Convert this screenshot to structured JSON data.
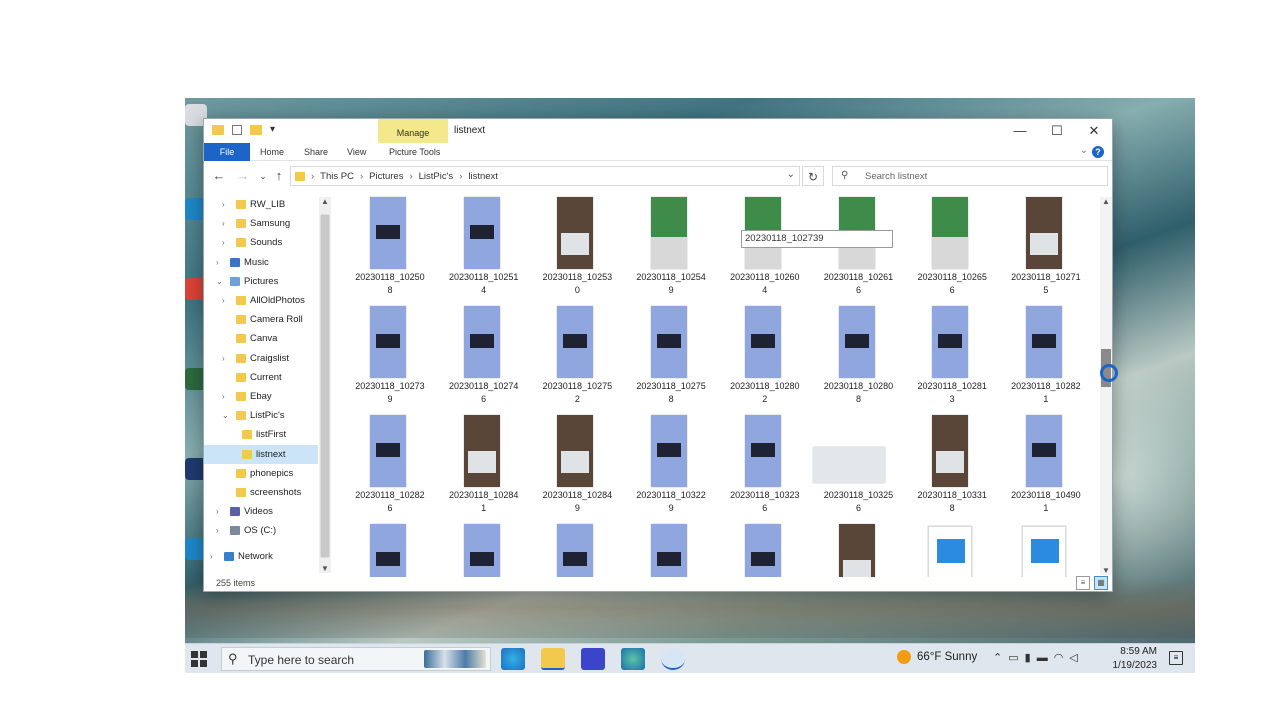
{
  "window": {
    "title": "listnext",
    "manage_tab": "Manage",
    "minimize": "—",
    "maximize": "☐",
    "close": "✕"
  },
  "ribbon": {
    "tabs": [
      "File",
      "Home",
      "Share",
      "View",
      "Picture Tools"
    ],
    "help": "?"
  },
  "address": {
    "crumbs": [
      "This PC",
      "Pictures",
      "ListPic's",
      "listnext"
    ],
    "search_placeholder": "Search listnext"
  },
  "nav_tree": [
    {
      "label": "RW_LIB",
      "indent": 2,
      "exp": ">",
      "kind": "folder"
    },
    {
      "label": "Samsung",
      "indent": 2,
      "exp": ">",
      "kind": "folder"
    },
    {
      "label": "Sounds",
      "indent": 2,
      "exp": ">",
      "kind": "folder"
    },
    {
      "label": "Music",
      "indent": 1,
      "exp": ">",
      "kind": "music"
    },
    {
      "label": "Pictures",
      "indent": 1,
      "exp": "v",
      "kind": "pictures"
    },
    {
      "label": "AllOldPhotos",
      "indent": 2,
      "exp": ">",
      "kind": "folder"
    },
    {
      "label": "Camera Roll",
      "indent": 2,
      "exp": "",
      "kind": "folder"
    },
    {
      "label": "Canva",
      "indent": 2,
      "exp": "",
      "kind": "folder"
    },
    {
      "label": "Craigslist",
      "indent": 2,
      "exp": ">",
      "kind": "folder"
    },
    {
      "label": "Current",
      "indent": 2,
      "exp": "",
      "kind": "folder"
    },
    {
      "label": "Ebay",
      "indent": 2,
      "exp": ">",
      "kind": "folder"
    },
    {
      "label": "ListPic's",
      "indent": 2,
      "exp": "v",
      "kind": "folder"
    },
    {
      "label": "listFirst",
      "indent": 3,
      "exp": "",
      "kind": "folder"
    },
    {
      "label": "listnext",
      "indent": 3,
      "exp": "",
      "kind": "folder",
      "selected": true
    },
    {
      "label": "phonepics",
      "indent": 2,
      "exp": "",
      "kind": "folder"
    },
    {
      "label": "screenshots",
      "indent": 2,
      "exp": "",
      "kind": "folder"
    },
    {
      "label": "Videos",
      "indent": 1,
      "exp": ">",
      "kind": "videos"
    },
    {
      "label": "OS (C:)",
      "indent": 1,
      "exp": ">",
      "kind": "drive"
    },
    {
      "label": "Network",
      "indent": 0,
      "exp": ">",
      "kind": "network"
    }
  ],
  "status": {
    "items_count": "255 items"
  },
  "files": [
    {
      "name": "20230118_10250\n8",
      "thumb": "blue"
    },
    {
      "name": "20230118_10251\n4",
      "thumb": "blue"
    },
    {
      "name": "20230118_10253\n0",
      "thumb": "dark"
    },
    {
      "name": "20230118_10254\n9",
      "thumb": "green"
    },
    {
      "name": "20230118_10260\n4",
      "thumb": "green"
    },
    {
      "name": "20230118_10261\n6",
      "thumb": "green"
    },
    {
      "name": "20230118_10265\n6",
      "thumb": "green"
    },
    {
      "name": "20230118_10271\n5",
      "thumb": "dark"
    },
    {
      "name": "20230118_10273\n9",
      "thumb": "blue"
    },
    {
      "name": "20230118_10274\n6",
      "thumb": "blue"
    },
    {
      "name": "20230118_10275\n2",
      "thumb": "blue"
    },
    {
      "name": "20230118_10275\n8",
      "thumb": "blue"
    },
    {
      "name": "20230118_10280\n2",
      "thumb": "blue"
    },
    {
      "name": "20230118_10280\n8",
      "thumb": "blue"
    },
    {
      "name": "20230118_10281\n3",
      "thumb": "blue"
    },
    {
      "name": "20230118_10282\n1",
      "thumb": "blue"
    },
    {
      "name": "20230118_10282\n6",
      "thumb": "blue"
    },
    {
      "name": "20230118_10284\n1",
      "thumb": "dark"
    },
    {
      "name": "20230118_10284\n9",
      "thumb": "dark"
    },
    {
      "name": "20230118_10322\n9",
      "thumb": "blue"
    },
    {
      "name": "20230118_10323\n6",
      "thumb": "blue"
    },
    {
      "name": "20230118_10325\n6",
      "thumb": "wide"
    },
    {
      "name": "20230118_10331\n8",
      "thumb": "dark"
    },
    {
      "name": "20230118_10490\n1",
      "thumb": "blue"
    },
    {
      "name": "",
      "thumb": "blue"
    },
    {
      "name": "",
      "thumb": "blue"
    },
    {
      "name": "",
      "thumb": "blue"
    },
    {
      "name": "",
      "thumb": "blue"
    },
    {
      "name": "",
      "thumb": "blue"
    },
    {
      "name": "",
      "thumb": "dark"
    },
    {
      "name": "",
      "thumb": "pic"
    },
    {
      "name": "",
      "thumb": "pic"
    }
  ],
  "tooltip": "20230118_102739",
  "taskbar": {
    "search_placeholder": "Type here to search",
    "weather": "66°F  Sunny",
    "time": "8:59 AM",
    "date": "1/19/2023"
  },
  "colors": {
    "accent": "#1c64c8",
    "manage": "#f3e98c",
    "selection": "#cce4f7",
    "folder": "#f2c94c"
  }
}
